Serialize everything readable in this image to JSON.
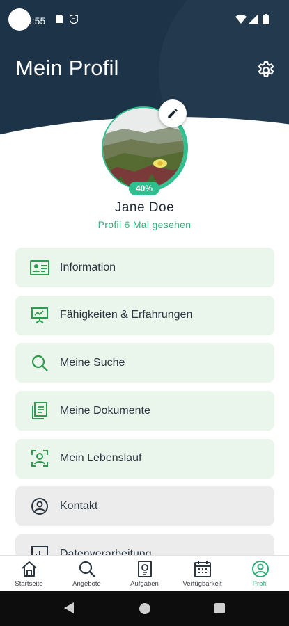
{
  "status_bar": {
    "time": "3:55"
  },
  "header": {
    "title": "Mein Profil"
  },
  "profile": {
    "name": "Jane Doe",
    "views_text": "Profil 6 Mal gesehen",
    "completion_label": "40%",
    "completion": 0.4
  },
  "menu": {
    "items": [
      {
        "label": "Information",
        "icon": "id-card-icon"
      },
      {
        "label": "Fähigkeiten & Erfahrungen",
        "icon": "presentation-board-icon"
      },
      {
        "label": "Meine Suche",
        "icon": "search-icon"
      },
      {
        "label": "Meine Dokumente",
        "icon": "documents-icon"
      },
      {
        "label": "Mein Lebenslauf",
        "icon": "face-scan-icon"
      },
      {
        "label": "Kontakt",
        "icon": "contact-icon"
      },
      {
        "label": "Datenverarbeitung",
        "icon": "data-chart-icon"
      }
    ]
  },
  "bottom_nav": {
    "items": [
      {
        "label": "Startseite",
        "icon": "home-icon"
      },
      {
        "label": "Angebote",
        "icon": "search-icon"
      },
      {
        "label": "Aufgaben",
        "icon": "clipboard-icon"
      },
      {
        "label": "Verfügbarkeit",
        "icon": "calendar-icon"
      },
      {
        "label": "Profil",
        "icon": "profile-icon"
      }
    ],
    "active": "Profil"
  },
  "colors": {
    "header_bg": "#1d3347",
    "accent_green": "#2fbf8f",
    "menu_green_bg": "#eaf5ec",
    "menu_grey_bg": "#ececec"
  }
}
